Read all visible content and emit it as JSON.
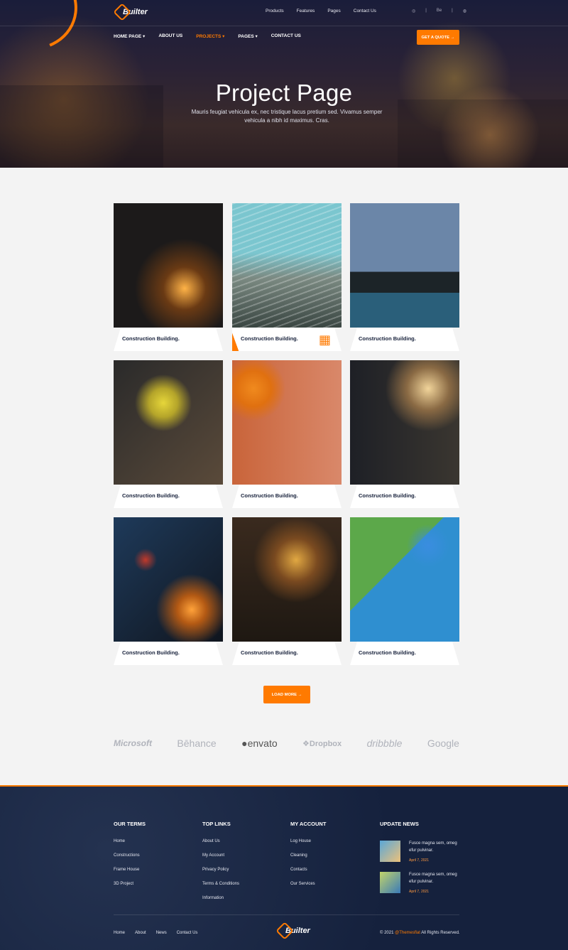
{
  "brand": {
    "name": "Builter"
  },
  "topbar": {
    "links": [
      "Products",
      "Features",
      "Pages",
      "Contact Us"
    ],
    "social": [
      "◎",
      "|",
      "Be",
      "|",
      "◍"
    ]
  },
  "nav": {
    "items": [
      "HOME PAGE ▾",
      "ABOUT US",
      "PROJECTS ▾",
      "PAGES ▾",
      "CONTACT US"
    ],
    "active_index": 2,
    "quote_button": "GET A QUOTE →"
  },
  "hero": {
    "title": "Project Page",
    "subtitle": "Mauris feugiat vehicula ex, nec tristique lacus pretium sed. Vivamus semper vehicula a nibh id maximus. Cras."
  },
  "projects": [
    {
      "caption": "Construction Building."
    },
    {
      "caption": "Construction Building."
    },
    {
      "caption": "Construction Building."
    },
    {
      "caption": "Construction Building."
    },
    {
      "caption": "Construction Building."
    },
    {
      "caption": "Construction Building."
    },
    {
      "caption": "Construction Building."
    },
    {
      "caption": "Construction Building."
    },
    {
      "caption": "Construction Building."
    }
  ],
  "load_more": "LOAD MORE →",
  "brands": [
    "Microsoft",
    "Bēhance",
    "●envato",
    "❖Dropbox",
    "dribbble",
    "Google"
  ],
  "footer": {
    "columns": [
      {
        "title": "OUR TERMS",
        "items": [
          "Home",
          "Constructions",
          "Frame House",
          "3D Project"
        ]
      },
      {
        "title": "TOP LINKS",
        "items": [
          "About Us",
          "My Account",
          "Privacy Policy",
          "Terms & Conditions",
          "Information"
        ]
      },
      {
        "title": "MY ACCOUNT",
        "items": [
          "Log House",
          "Cleaning",
          "Contacts",
          "Our Services"
        ]
      }
    ],
    "news_title": "UPDATE NEWS",
    "news": [
      {
        "text": "Fusce magna sem, omeg efur pulvinar.",
        "date": "April 7, 2021"
      },
      {
        "text": "Fusce magna sem, omeg efur pulvinar.",
        "date": "April 7, 2021"
      }
    ],
    "bottom_links": [
      "Home",
      "About",
      "News",
      "Contact Us"
    ],
    "copyright_pre": "© 2021 ",
    "copyright_org": "@Themesflat",
    "copyright_post": " All Rights Reserved."
  },
  "colors": {
    "accent": "#ff7a00",
    "dark_navy": "#16203a"
  },
  "icons": {
    "building": "building-icon"
  }
}
